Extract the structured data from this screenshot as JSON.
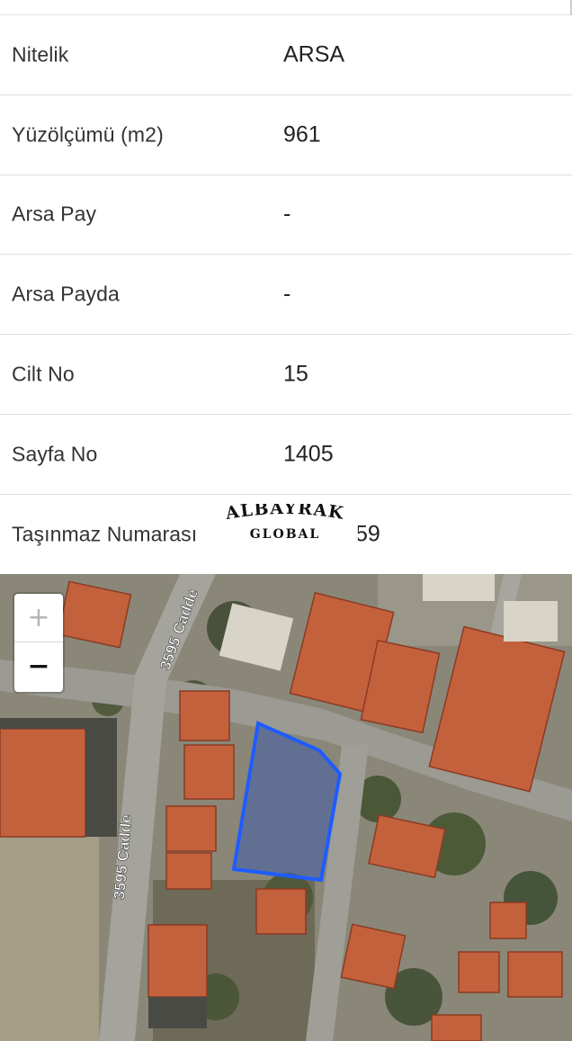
{
  "property_info": {
    "rows": [
      {
        "label": "Nitelik",
        "value": "ARSA"
      },
      {
        "label": "Yüzölçümü (m2)",
        "value": "961"
      },
      {
        "label": "Arsa Pay",
        "value": "-"
      },
      {
        "label": "Arsa Payda",
        "value": "-"
      },
      {
        "label": "Cilt No",
        "value": "15"
      },
      {
        "label": "Sayfa No",
        "value": "1405"
      },
      {
        "label": "Taşınmaz Numarası",
        "value": "59"
      }
    ]
  },
  "watermark": {
    "line1": "ALBAYRAK",
    "line2": "GLOBAL"
  },
  "map": {
    "zoom_in_label": "+",
    "zoom_out_label": "−",
    "street_labels": [
      "3595 Cadde",
      "3595 Cadde"
    ],
    "parcel_outline_color": "#1f5cff",
    "roof_color": "#c9653f"
  }
}
